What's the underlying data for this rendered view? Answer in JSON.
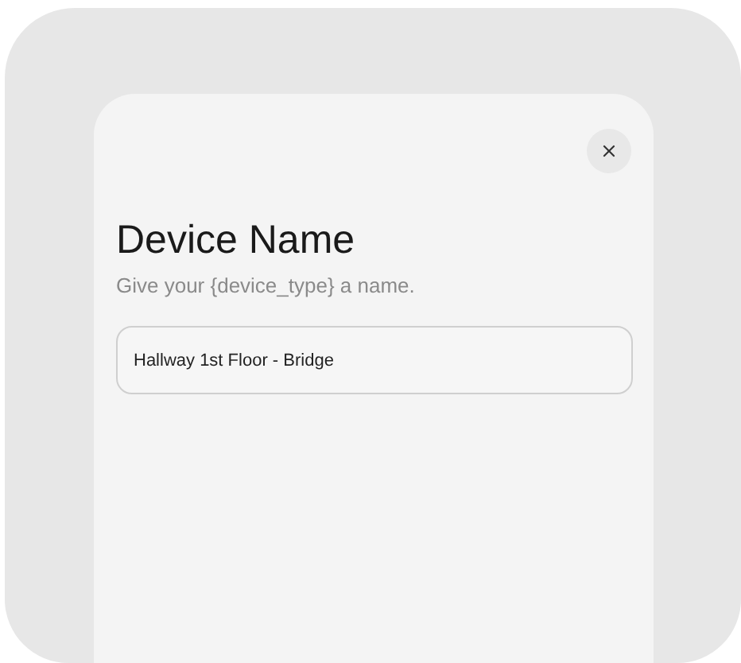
{
  "dialog": {
    "title": "Device Name",
    "subtitle": "Give your {device_type} a name.",
    "name_field": {
      "value": "Hallway 1st Floor - Bridge"
    }
  }
}
